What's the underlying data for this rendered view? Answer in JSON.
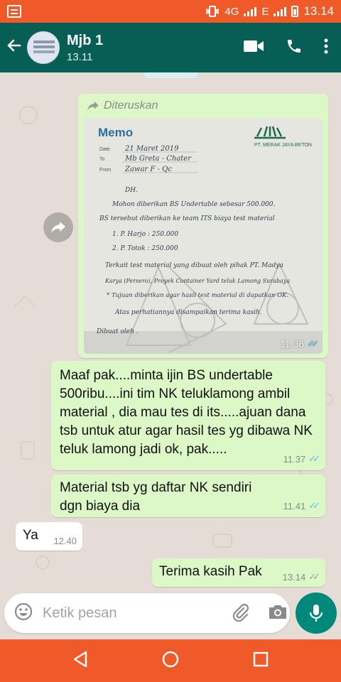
{
  "status_bar": {
    "network": "4G",
    "network2": "E",
    "time": "13.14"
  },
  "header": {
    "title": "Mjb 1",
    "subtitle": "13.11"
  },
  "messages": [
    {
      "type": "image",
      "direction": "out",
      "forwarded_label": "Diteruskan",
      "time": "11.36",
      "status": "read",
      "image_text": {
        "heading": "Memo",
        "company": "PT. MERAK JAYA BETON",
        "date_label": "Date",
        "date_value": "21 Maret 2019",
        "to_label": "To",
        "to_value": "Mb Greta - Chater",
        "from_label": "From",
        "from_value": "Zawar F - Qc",
        "lines": [
          "DH.",
          "Mohon diberikan BS Undertable sebesar 500.000.",
          "BS tersebut diberikan ke team ITS biaya test material",
          "1. P. Harjo    : 250.000",
          "2. P. Totok    : 250.000",
          "Terkait test material yang dibuat oleh pihak PT. Madya",
          "Karya (Persero), Proyek Container Yard teluk Lamong Surabaya",
          "* Tujuan diberikan agar hasil test material di dapatkan OK.",
          "Atas perhatiannya disampaikan terima kasih.",
          "Dibuat oleh ."
        ]
      }
    },
    {
      "type": "text",
      "direction": "out",
      "text": "Maaf pak....minta ijin BS undertable 500ribu....ini tim NK teluklamong ambil material , dia mau tes di its.....ajuan dana tsb untuk atur agar hasil tes yg dibawa NK teluk lamong jadi ok, pak.....",
      "time": "11.37",
      "status": "read"
    },
    {
      "type": "text",
      "direction": "out",
      "text": "Material tsb yg daftar NK sendiri dgn biaya dia",
      "time": "11.41",
      "status": "read"
    },
    {
      "type": "text",
      "direction": "in",
      "text": "Ya",
      "time": "12.40"
    },
    {
      "type": "text",
      "direction": "out",
      "text": "Terima kasih Pak",
      "time": "13.14",
      "status": "delivered"
    }
  ],
  "composer": {
    "placeholder": "Ketik pesan"
  },
  "colors": {
    "status_bar": "#f05a28",
    "app_bar": "#075e54",
    "bubble_out": "#dcf8c6",
    "bubble_in": "#ffffff",
    "chat_bg": "#e5ddd5",
    "mic_button": "#00897b",
    "read_ticks": "#4fc3f7"
  },
  "icons": {
    "back": "arrow-left-icon",
    "video": "video-call-icon",
    "call": "phone-icon",
    "menu": "more-vertical-icon",
    "emoji": "emoji-icon",
    "attach": "paperclip-icon",
    "camera": "camera-icon",
    "mic": "mic-icon",
    "forward": "forward-icon"
  }
}
